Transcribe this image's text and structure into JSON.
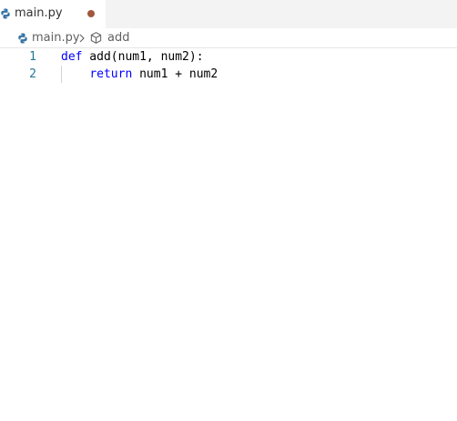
{
  "tabs": [
    {
      "label": "main.py",
      "icon": "python-file-icon",
      "dirty": true,
      "active": true
    }
  ],
  "breadcrumb": {
    "file": "main.py",
    "file_icon": "python-file-icon",
    "separator_icon": "chevron-right-icon",
    "symbol_icon": "method-cube-icon",
    "symbol": "add"
  },
  "editor": {
    "lines": [
      {
        "number": "1",
        "keyword": "def",
        "rest": " add(num1, num2):",
        "indent": ""
      },
      {
        "number": "2",
        "keyword": "return",
        "rest": " num1 + num2",
        "indent": "    "
      }
    ]
  },
  "colors": {
    "tab_bar_bg": "#f3f3f3",
    "dirty_dot": "#a0583d",
    "keyword": "#0000ff",
    "line_number": "#237893",
    "breadcrumb_text": "#616161"
  }
}
